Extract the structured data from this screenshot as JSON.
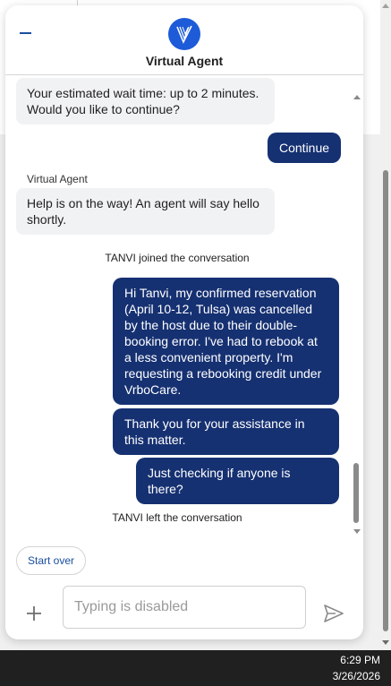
{
  "header": {
    "title": "Virtual Agent"
  },
  "messages": {
    "bot_wait": "Your estimated wait time: up to 2 minutes. Would you like to continue?",
    "user_continue": "Continue",
    "sender_virtual_agent": "Virtual Agent",
    "bot_help": "Help is on the way! An agent will say hello shortly.",
    "system_joined": "TANVI joined the conversation",
    "user_msg_1": "Hi Tanvi, my confirmed reservation (April 10-12, Tulsa) was cancelled by the host due to their double-booking error. I've had to rebook at a less convenient property. I'm requesting a rebooking credit under VrboCare.",
    "user_msg_2": "Thank you for your assistance in this matter.",
    "user_msg_3": "Just checking if anyone is there?",
    "system_left": "TANVI left the conversation"
  },
  "actions": {
    "start_over": "Start over"
  },
  "composer": {
    "placeholder": "Typing is disabled"
  },
  "taskbar": {
    "time": "6:29 PM",
    "date": "3/26/2026"
  },
  "colors": {
    "user_bubble": "#163172",
    "bot_bubble": "#f1f2f4",
    "accent": "#1d5bd8",
    "link": "#1a4fa0"
  },
  "icons": [
    "minimize-icon",
    "virtual-agent-logo-icon",
    "plus-icon",
    "send-icon"
  ]
}
